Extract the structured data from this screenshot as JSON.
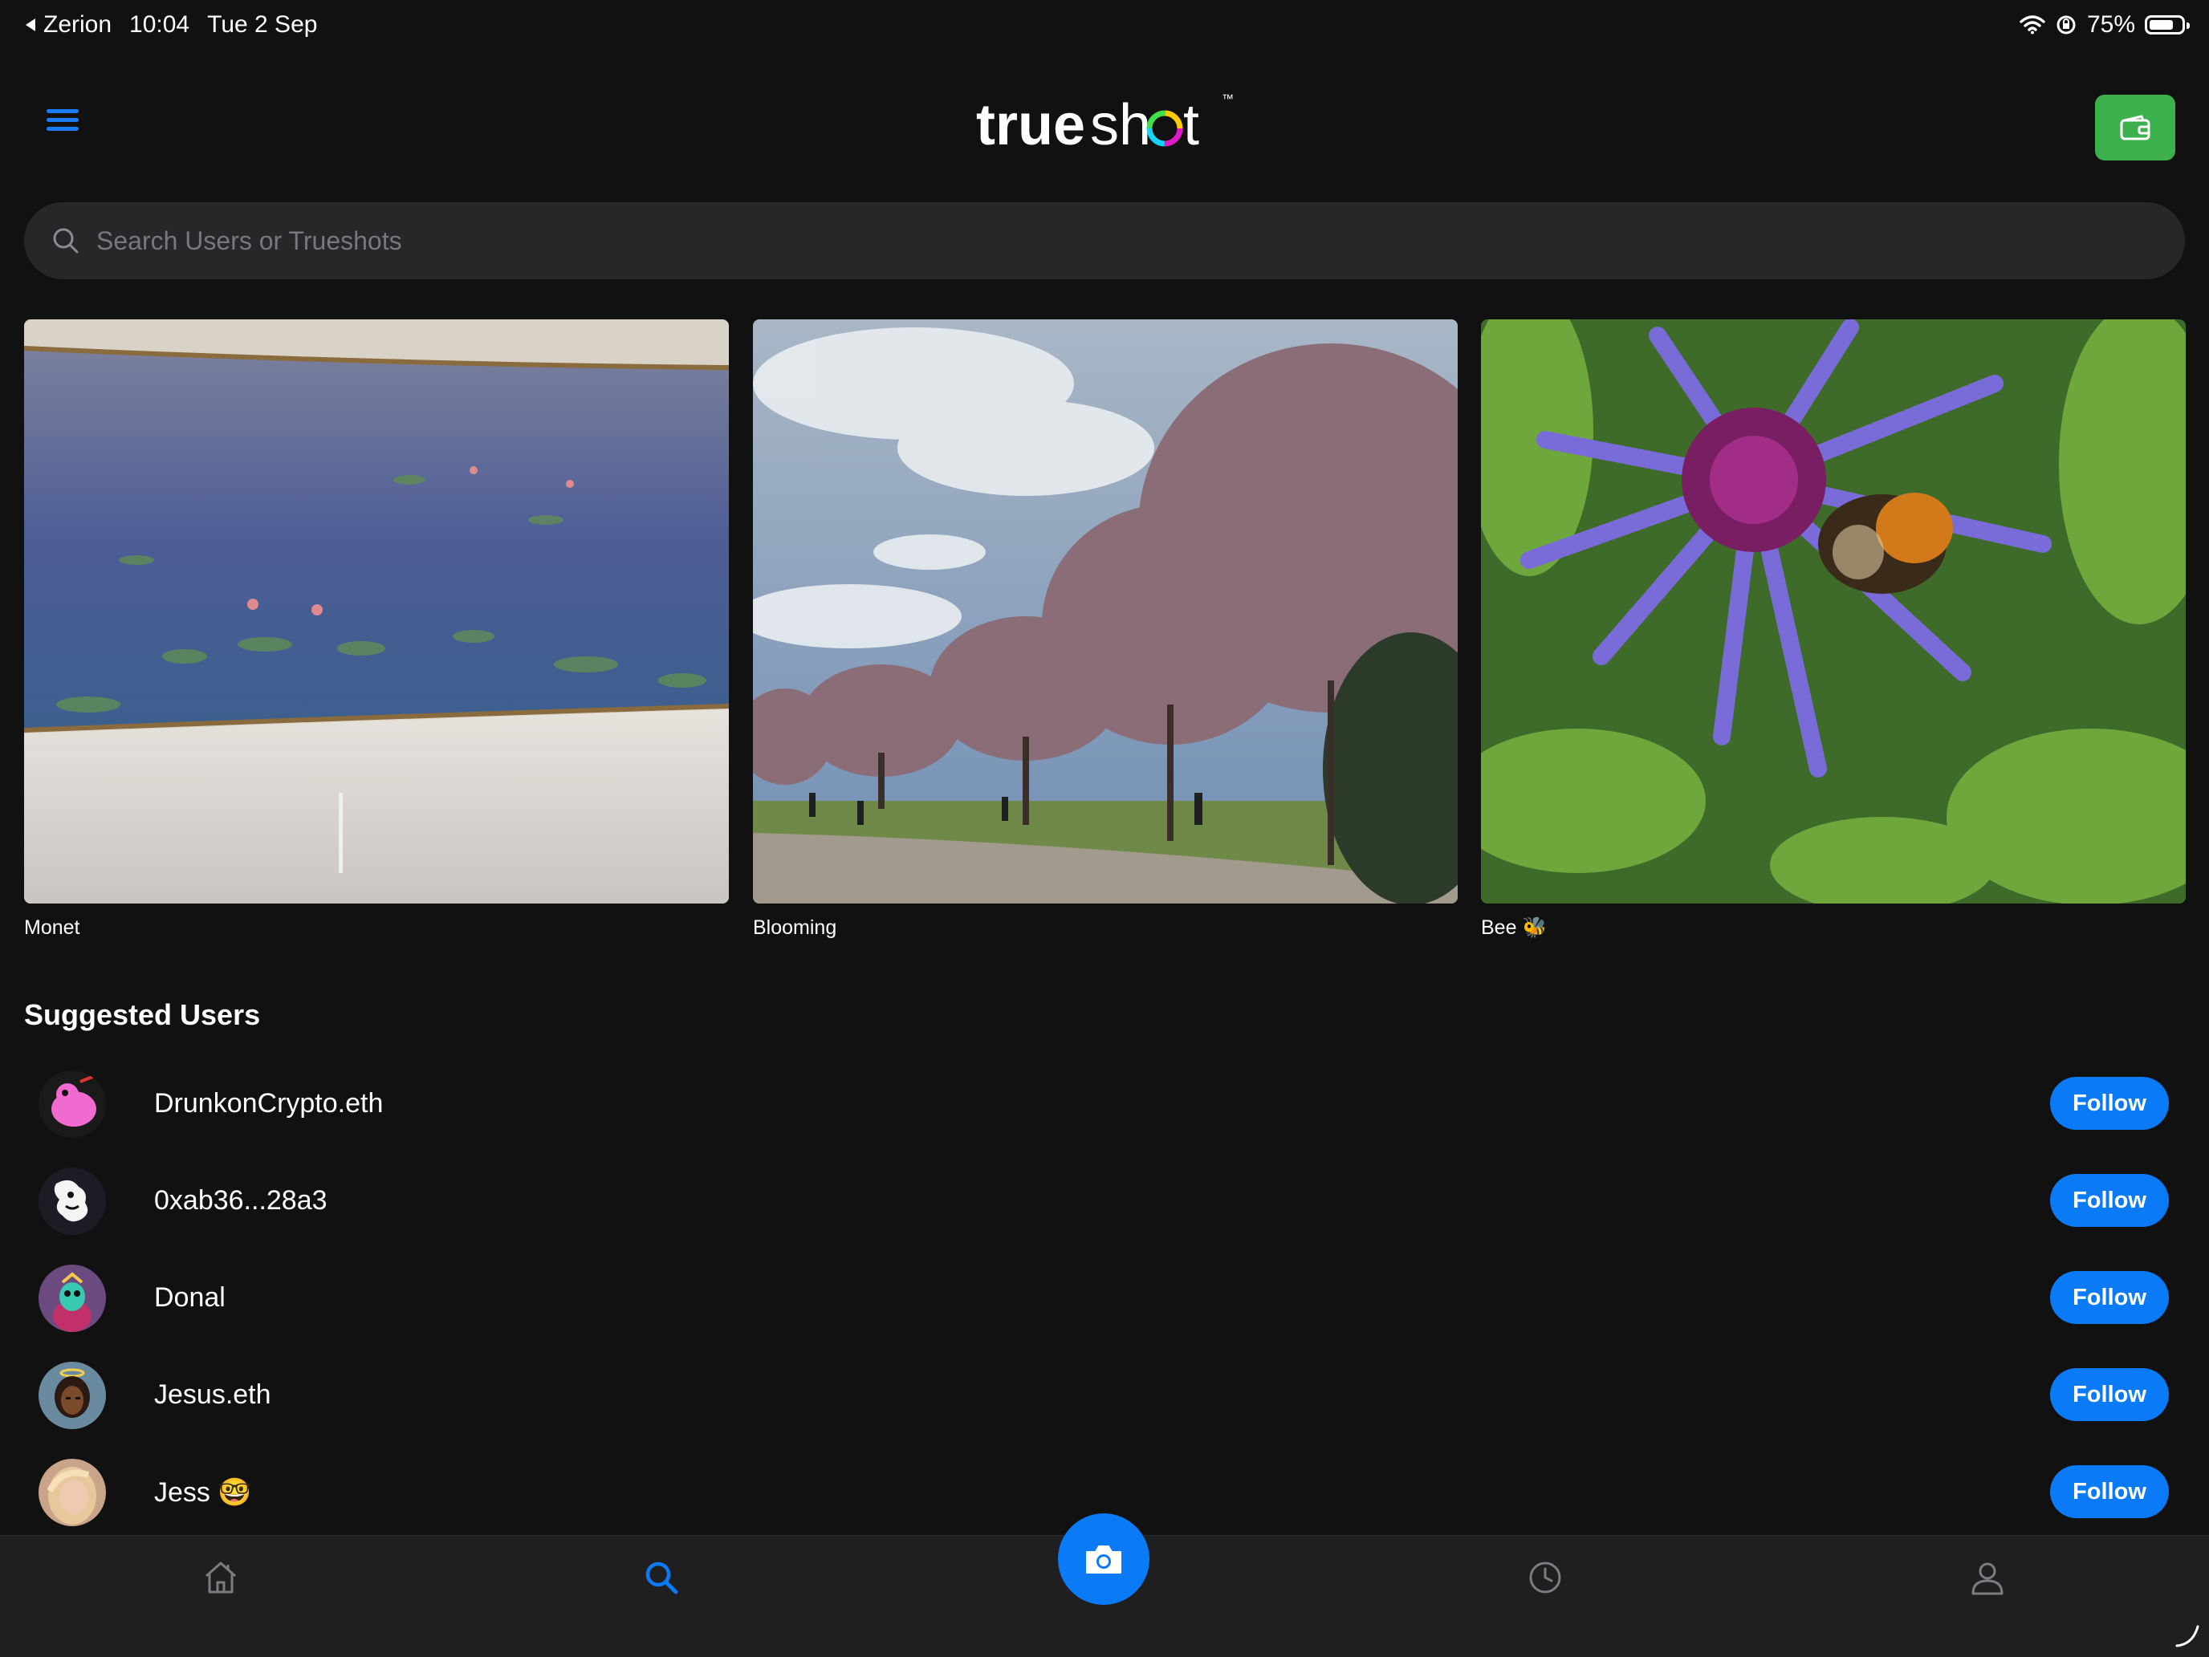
{
  "status_bar": {
    "back_app": "Zerion",
    "time": "10:04",
    "date": "Tue 2 Sep",
    "battery": "75%",
    "battery_level": 0.75
  },
  "header": {
    "logo_text_a": "true",
    "logo_text_b": "sh",
    "logo_text_c": "t",
    "logo_tm": "™"
  },
  "search": {
    "placeholder": "Search Users or Trueshots"
  },
  "photos": [
    {
      "caption": "Monet",
      "icon": "water-lilies-painting"
    },
    {
      "caption": "Blooming",
      "icon": "blossom-trees-park"
    },
    {
      "caption": "Bee 🐝",
      "icon": "bee-on-cornflower"
    }
  ],
  "suggested": {
    "title": "Suggested Users",
    "follow_label": "Follow",
    "users": [
      {
        "name": "DrunkonCrypto.eth"
      },
      {
        "name": "0xab36...28a3"
      },
      {
        "name": "Donal"
      },
      {
        "name": "Jesus.eth"
      },
      {
        "name": "Jess 🤓"
      }
    ]
  },
  "tabbar": {
    "tabs": [
      "home-icon",
      "search-icon",
      "camera-icon",
      "history-icon",
      "profile-icon"
    ],
    "active": "search-icon"
  },
  "colors": {
    "accent": "#0a7af7",
    "wallet": "#3bb04d",
    "background": "#111112"
  }
}
